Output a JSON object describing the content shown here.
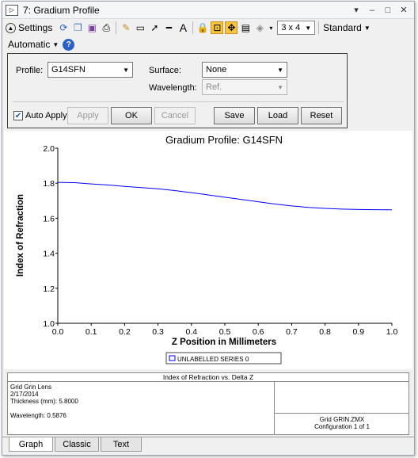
{
  "window": {
    "title": "7: Gradium Profile",
    "buttons": [
      "▾",
      "–",
      "□",
      "✕"
    ]
  },
  "toolbar": {
    "settings_label": "Settings",
    "layout_value": "3 x 4",
    "standard_label": "Standard",
    "text_tool": "A",
    "automatic_label": "Automatic"
  },
  "settings": {
    "profile_label": "Profile:",
    "profile_value": "G14SFN",
    "surface_label": "Surface:",
    "surface_value": "None",
    "wavelength_label": "Wavelength:",
    "wavelength_value": "Ref.",
    "auto_apply_label": "Auto Apply",
    "apply_label": "Apply",
    "ok_label": "OK",
    "cancel_label": "Cancel",
    "save_label": "Save",
    "load_label": "Load",
    "reset_label": "Reset"
  },
  "chart_data": {
    "type": "line",
    "title": "Gradium Profile: G14SFN",
    "xlabel": "Z Position in Millimeters",
    "ylabel": "Index of Refraction",
    "xlim": [
      0.0,
      1.0
    ],
    "ylim": [
      1.0,
      2.0
    ],
    "x_ticks": [
      "0.0",
      "0.1",
      "0.2",
      "0.3",
      "0.4",
      "0.5",
      "0.6",
      "0.7",
      "0.8",
      "0.9",
      "1.0"
    ],
    "y_ticks": [
      "1.0",
      "1.2",
      "1.4",
      "1.6",
      "1.8",
      "2.0"
    ],
    "grid": false,
    "legend": "bottom-center",
    "series": [
      {
        "name": "UNLABELLED SERIES 0",
        "color": "#0000ff",
        "x": [
          0.0,
          0.05,
          0.1,
          0.15,
          0.2,
          0.25,
          0.3,
          0.35,
          0.4,
          0.45,
          0.5,
          0.55,
          0.6,
          0.65,
          0.7,
          0.75,
          0.8,
          0.85,
          0.9,
          0.95,
          1.0
        ],
        "y": [
          1.805,
          1.803,
          1.796,
          1.79,
          1.782,
          1.775,
          1.768,
          1.758,
          1.746,
          1.733,
          1.72,
          1.707,
          1.694,
          1.681,
          1.67,
          1.662,
          1.656,
          1.652,
          1.65,
          1.649,
          1.648
        ]
      }
    ]
  },
  "info": {
    "heading": "Index of Refraction vs. Delta Z",
    "lens_name": "Grid Grin Lens",
    "date": "2/17/2014",
    "thickness": "Thickness (mm): 5.8000",
    "wavelength": "Wavelength: 0.5876",
    "file_name": "Grid GRIN.ZMX",
    "configuration": "Configuration 1 of 1"
  },
  "tabs": [
    "Graph",
    "Classic",
    "Text"
  ],
  "colors": {
    "accent": "#f7c53c",
    "series": "#0000ff"
  }
}
